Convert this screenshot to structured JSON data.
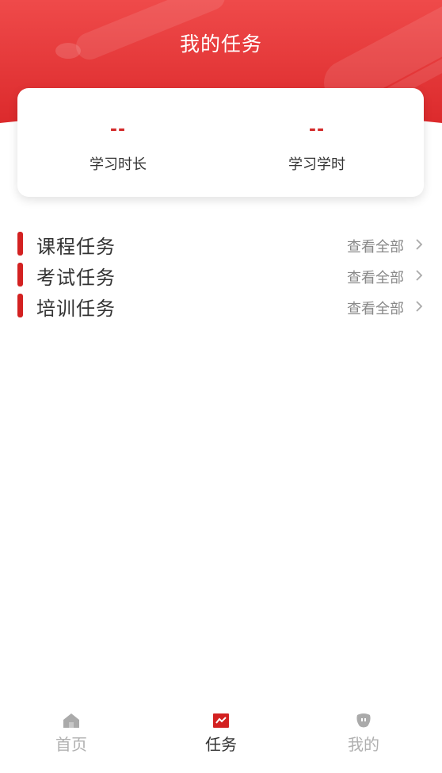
{
  "header": {
    "title": "我的任务",
    "background_color": "#e8383a"
  },
  "stats": [
    {
      "value": "--",
      "label": "学习时长"
    },
    {
      "value": "--",
      "label": "学习学时"
    }
  ],
  "tasks": [
    {
      "title": "课程任务",
      "more_label": "查看全部"
    },
    {
      "title": "考试任务",
      "more_label": "查看全部"
    },
    {
      "title": "培训任务",
      "more_label": "查看全部"
    }
  ],
  "bottom_nav": {
    "items": [
      {
        "label": "首页",
        "icon": "home-icon",
        "active": false
      },
      {
        "label": "任务",
        "icon": "task-icon",
        "active": true
      },
      {
        "label": "我的",
        "icon": "profile-icon",
        "active": false
      }
    ]
  },
  "colors": {
    "accent": "#d32121",
    "active_text": "#333333",
    "inactive_text": "#b0b0b0"
  }
}
